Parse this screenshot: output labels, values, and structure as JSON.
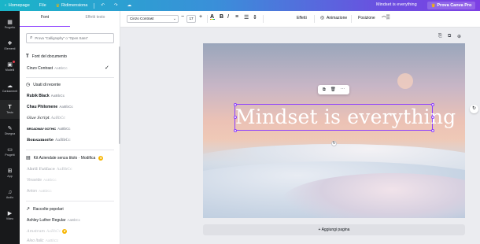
{
  "topbar": {
    "home": "Homepage",
    "file": "File",
    "resize": "Ridimensiona",
    "title": "Mindset is everything",
    "pro_button": "Prova Canva Pro"
  },
  "rail": [
    {
      "label": "Progetto",
      "icon": "layout-icon"
    },
    {
      "label": "Elementi",
      "icon": "shapes-icon"
    },
    {
      "label": "Modelli",
      "icon": "templates-icon"
    },
    {
      "label": "Caricamenti",
      "icon": "upload-icon"
    },
    {
      "label": "Testo",
      "icon": "text-icon"
    },
    {
      "label": "Disegna",
      "icon": "draw-icon"
    },
    {
      "label": "Progetti",
      "icon": "folder-icon"
    },
    {
      "label": "App",
      "icon": "apps-icon"
    },
    {
      "label": "Audio",
      "icon": "audio-icon"
    },
    {
      "label": "Video",
      "icon": "video-icon"
    }
  ],
  "panel": {
    "tab_font": "Font",
    "tab_effects": "Effetti testo",
    "search_placeholder": "Prova \"Calligraphy\" o \"Open Sans\"",
    "section_doc": "Font del documento",
    "doc_font": "Cinzo Contrast",
    "doc_font_sample": "AaBbCc",
    "section_recent": "Usati di recente",
    "recent": [
      {
        "name": "Rubik Black",
        "sample": "AaBbCc"
      },
      {
        "name": "Chau Philomene",
        "sample": "AaBbCc"
      },
      {
        "name": "Glue Script",
        "sample": "AaBbCc"
      },
      {
        "name": "BROADWAY GOTHIC",
        "sample": "AaBbCc"
      },
      {
        "name": "Bonsamorte",
        "sample": "AaBbCc"
      }
    ],
    "section_kit": "Kit Aziendale senza titolo · Modifica",
    "kit": [
      {
        "name": "Abril Fatface",
        "sample": "AaBbCc"
      },
      {
        "name": "Vinavide",
        "sample": "AaBbCc"
      },
      {
        "name": "Anton",
        "sample": "AaBbCc"
      }
    ],
    "section_popular": "Raccolte popolari",
    "popular": [
      {
        "name": "Ashley Luther Regular",
        "sample": "AaBbCc"
      },
      {
        "name": "Amstram",
        "sample": "AaBbCc"
      },
      {
        "name": "Aleo Italic",
        "sample": "AaBbCc"
      }
    ]
  },
  "toolbar": {
    "font": "Cinzo Contrast",
    "size": "17",
    "effects": "Effetti",
    "animate": "Animazione",
    "position": "Posizione"
  },
  "canvas": {
    "headline": "Mindset is everything",
    "add_page": "+ Aggiungi pagina"
  },
  "colors": {
    "accent": "#8b3dff",
    "rail_bg": "#18191b",
    "crown": "#f7b500"
  }
}
